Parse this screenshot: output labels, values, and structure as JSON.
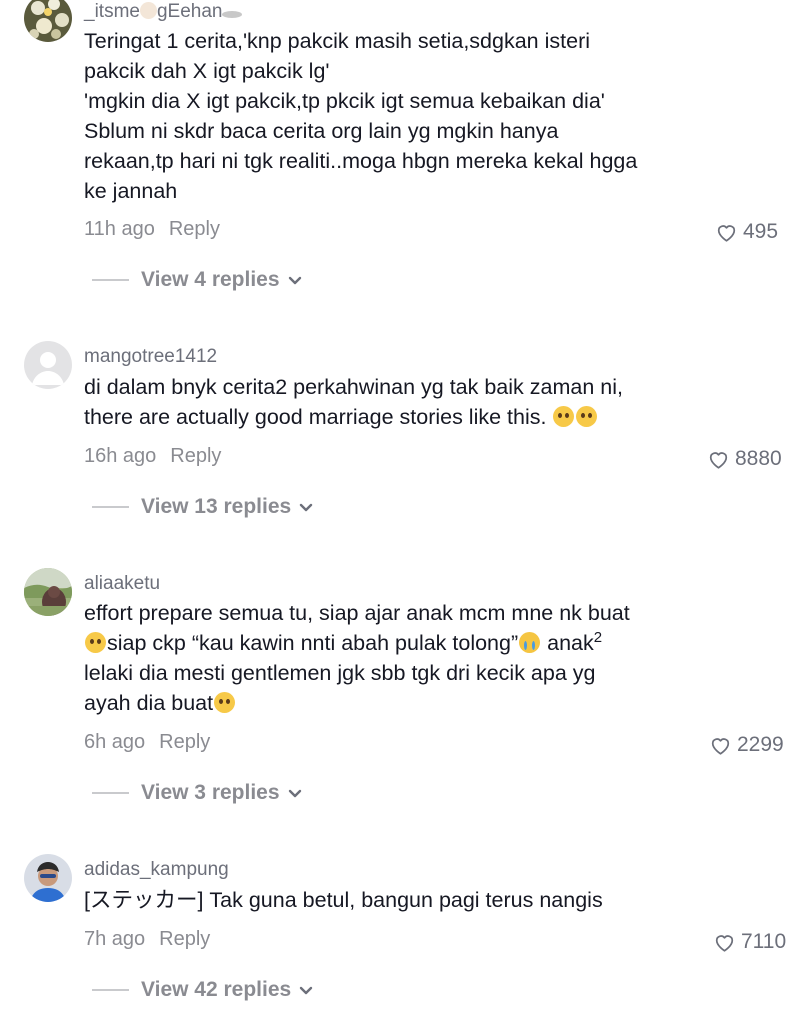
{
  "comments": [
    {
      "username_parts": [
        "_itsme",
        "gEehan"
      ],
      "lines": [
        "Teringat 1 cerita,'knp pakcik masih setia,sdgkan isteri",
        "pakcik dah X igt pakcik lg'",
        "'mgkin dia X igt pakcik,tp pkcik igt semua kebaikan dia'",
        "Sblum ni skdr baca cerita org lain yg mgkin hanya",
        "rekaan,tp hari ni tgk realiti..moga hbgn mereka kekal hgga",
        "ke jannah"
      ],
      "time": "11h ago",
      "reply_label": "Reply",
      "likes": "495",
      "view_replies": "View 4 replies"
    },
    {
      "username": "mangotree1412",
      "lines": [
        "di dalam bnyk cerita2 perkahwinan yg tak baik zaman ni,",
        "there are actually good marriage stories like this."
      ],
      "time": "16h ago",
      "reply_label": "Reply",
      "likes": "8880",
      "view_replies": "View 13 replies"
    },
    {
      "username": "aliaaketu",
      "line1": "effort prepare semua tu, siap ajar anak mcm mne nk buat",
      "line2_a": "siap ckp “kau kawin nnti abah pulak tolong”",
      "line2_b": " anak",
      "line2_sup": "2",
      "line3": "lelaki dia mesti gentlemen jgk sbb tgk dri kecik apa yg",
      "line4": "ayah dia buat",
      "time": "6h ago",
      "reply_label": "Reply",
      "likes": "2299",
      "view_replies": "View 3 replies"
    },
    {
      "username": "adidas_kampung",
      "lines": [
        "[ステッカー] Tak guna betul, bangun pagi terus nangis"
      ],
      "time": "7h ago",
      "reply_label": "Reply",
      "likes": "7110",
      "view_replies": "View 42 replies"
    }
  ],
  "icons": {
    "heart": "heart-outline-icon",
    "chevron": "chevron-down-icon"
  },
  "colors": {
    "text": "#161823",
    "muted": "#8a8b91",
    "username": "#6c6f7a"
  }
}
